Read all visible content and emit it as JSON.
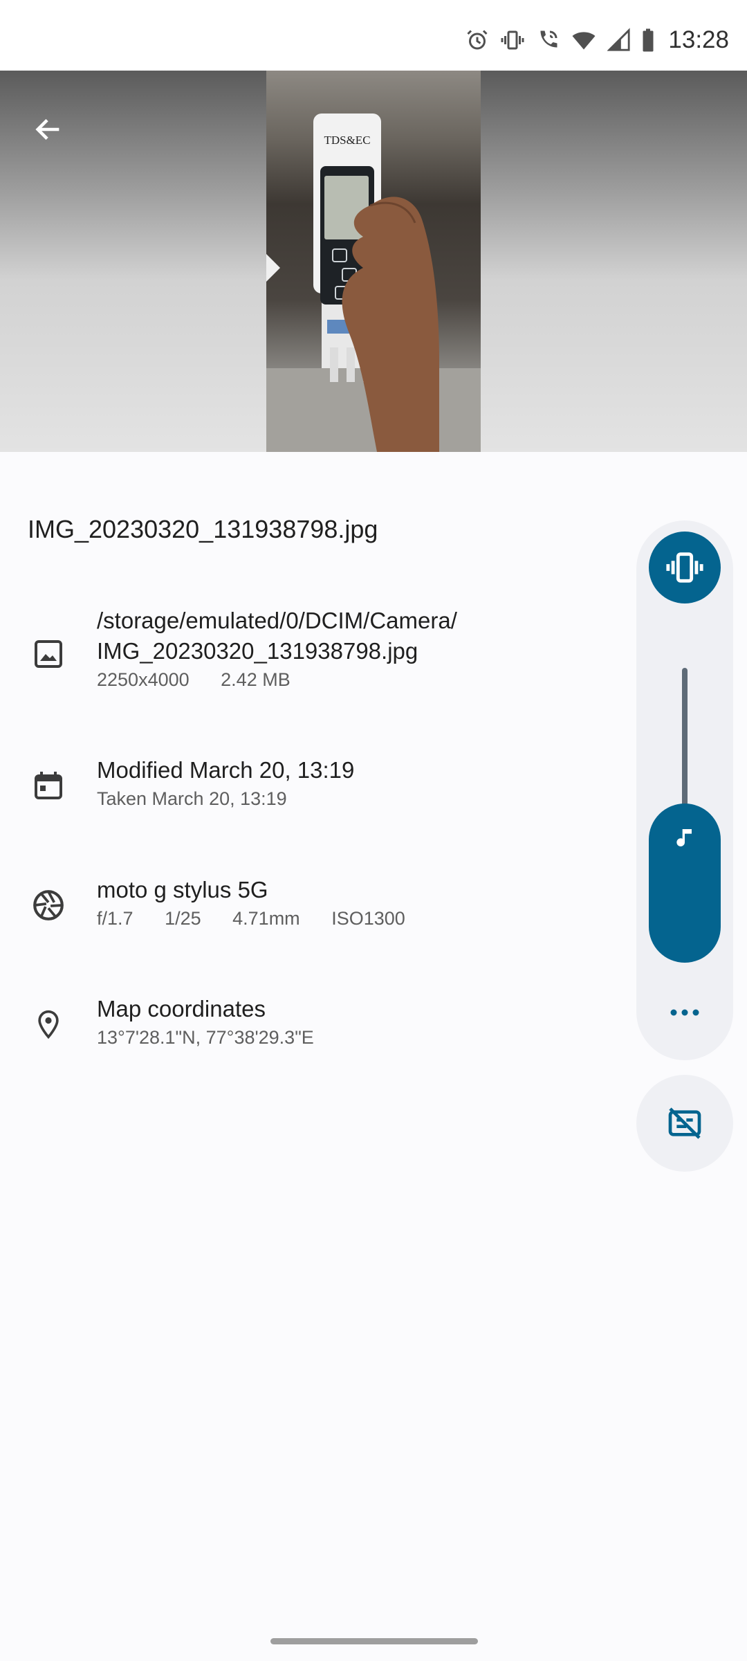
{
  "status_bar": {
    "time": "13:28",
    "icons": [
      "alarm-icon",
      "vibrate-icon",
      "wifi-calling-icon",
      "wifi-icon",
      "signal-icon",
      "battery-icon"
    ]
  },
  "photo_header": {
    "back_icon": "arrow-back-icon",
    "photo_text": "TDS&EC"
  },
  "details": {
    "file_name": "IMG_20230320_131938798.jpg",
    "path": {
      "icon": "image-icon",
      "line1": "/storage/emulated/0/DCIM/Camera/",
      "line2": "IMG_20230320_131938798.jpg",
      "resolution": "2250x4000",
      "size": "2.42 MB"
    },
    "date": {
      "icon": "calendar-icon",
      "modified": "Modified March 20, 13:19",
      "taken": "Taken March 20, 13:19"
    },
    "camera": {
      "icon": "aperture-icon",
      "model": "moto g stylus 5G",
      "aperture": "f/1.7",
      "shutter": "1/25",
      "focal_length": "4.71mm",
      "iso": "ISO1300"
    },
    "location": {
      "icon": "location-pin-icon",
      "title": "Map coordinates",
      "coords": "13°7'28.1\"N, 77°38'29.3\"E"
    }
  },
  "volume_panel": {
    "ringer_mode_icon": "vibrate-icon",
    "stream_icon": "music-note-icon",
    "level": 0.3,
    "more_icon": "more-dots-icon",
    "captions_icon": "captions-off-icon",
    "accent_color": "#04648f"
  }
}
